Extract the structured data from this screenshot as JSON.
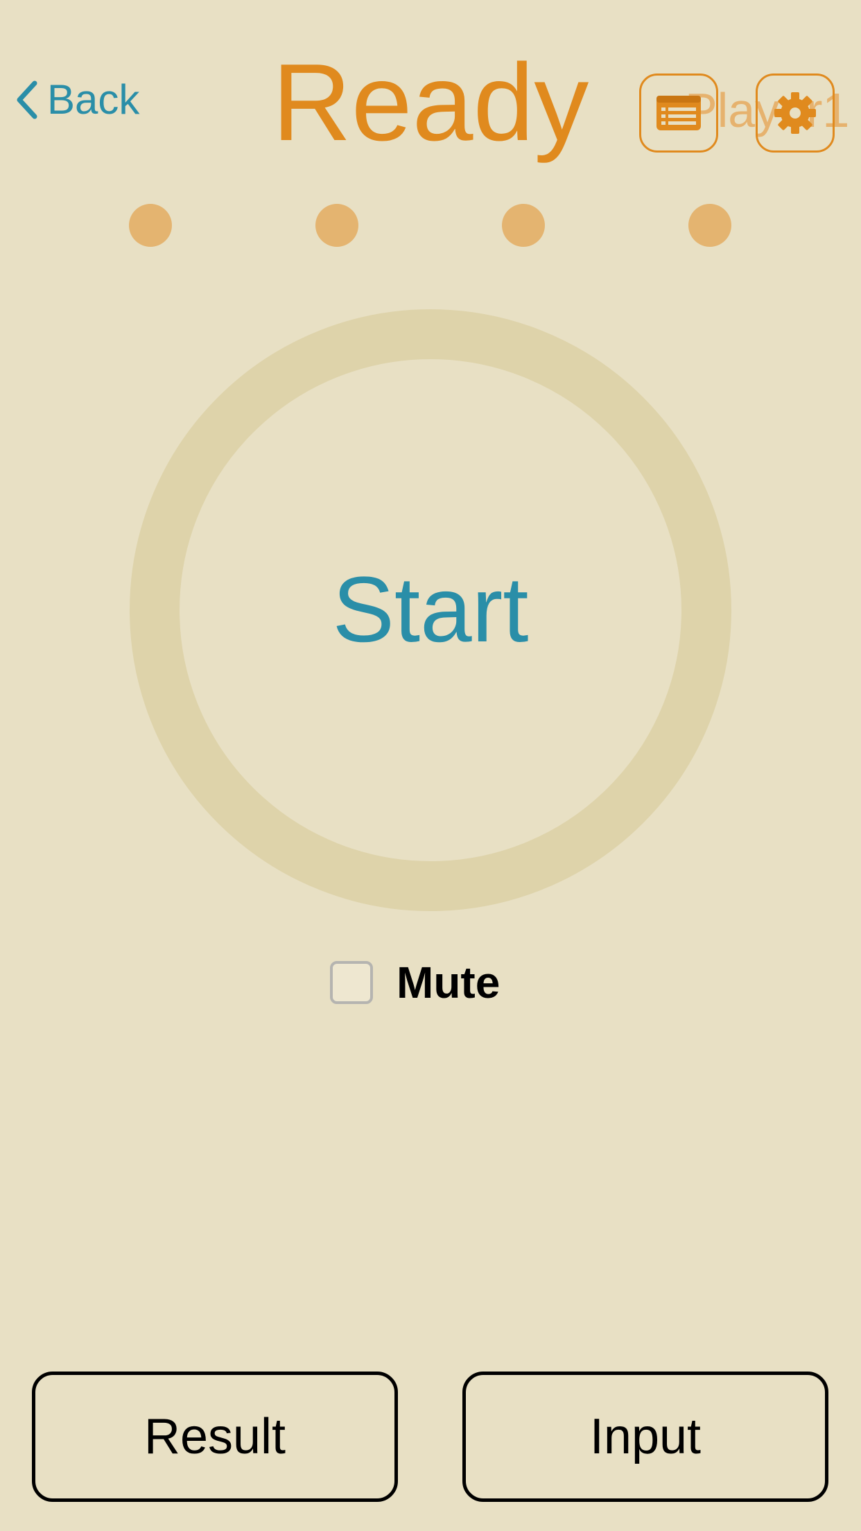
{
  "header": {
    "back_label": "Back",
    "title": "Ready",
    "player_label": "Player1"
  },
  "progress": {
    "total_steps": 4,
    "completed_steps": 0
  },
  "main": {
    "start_label": "Start",
    "mute_label": "Mute",
    "mute_checked": false
  },
  "footer": {
    "result_label": "Result",
    "input_label": "Input"
  },
  "colors": {
    "background": "#E8E0C4",
    "accent_orange": "#E08A1E",
    "accent_teal": "#2A8EA8",
    "dot_color": "#E4B470",
    "ring_color": "#DED3AA"
  },
  "icons": {
    "back": "chevron-left-icon",
    "list": "list-icon",
    "settings": "gear-icon"
  }
}
